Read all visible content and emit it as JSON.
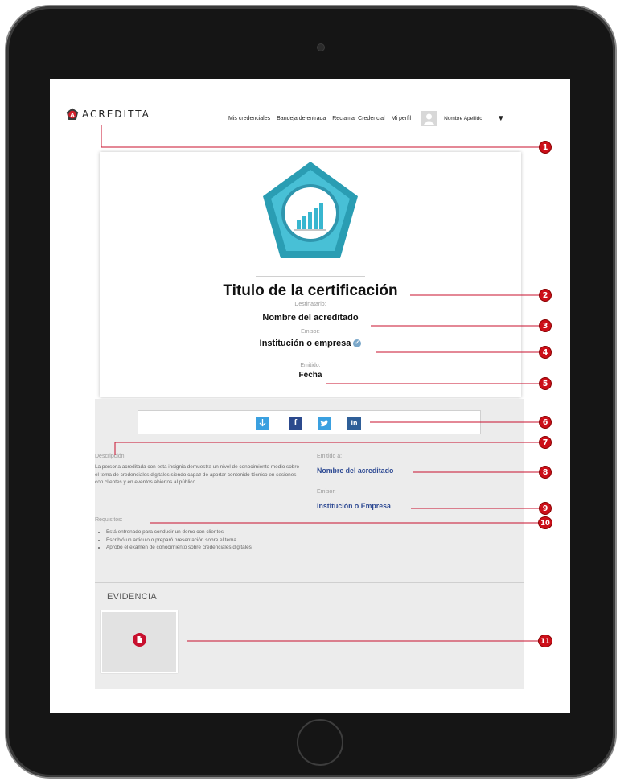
{
  "brand": {
    "name": "ACREDITTA"
  },
  "nav": {
    "items": [
      "Mis credenciales",
      "Bandeja de entrada",
      "Reclamar Credencial",
      "Mi perfil"
    ],
    "user_name": "Nombre Apellido",
    "dropdown": "▼"
  },
  "credential": {
    "title": "Titulo de la certificación",
    "recipient_label": "Destinatario:",
    "recipient": "Nombre del acreditado",
    "issuer_label": "Emisor:",
    "issuer": "Institución o empresa",
    "issued_label": "Emitido:",
    "issued": "Fecha"
  },
  "share": {
    "icons": [
      "download-icon",
      "facebook-icon",
      "twitter-icon",
      "linkedin-icon"
    ],
    "facebook": "f",
    "linkedin": "in"
  },
  "details": {
    "description_label": "Descripción:",
    "description": "La persona acreditada con esta insignia demuestra un nivel de conocimiento medio sobre el tema de credenciales digitales siendo capaz de aportar contenido técnico en sesiones con clientes y en eventos abiertos al público",
    "issued_to_label": "Emitido a:",
    "issued_to": "Nombre del acreditado",
    "issuer_label": "Emisor:",
    "issuer": "Institución o Empresa",
    "requirements_label": "Requisitos:",
    "requirements": [
      "Está entrenado para conducir un demo con clientes",
      "Escribió un articulo o preparó presentación sobre el tema",
      "Aprobó el examen de conocimiento sobre credenciales digitales"
    ]
  },
  "evidence": {
    "title": "EVIDENCIA"
  },
  "annotations": [
    "1",
    "2",
    "3",
    "4",
    "5",
    "6",
    "7",
    "8",
    "9",
    "10",
    "11"
  ],
  "colors": {
    "accent": "#cc0f19",
    "link": "#2e4a93",
    "badge_outer": "#2a9db3",
    "badge_inner": "#48c0d6"
  }
}
